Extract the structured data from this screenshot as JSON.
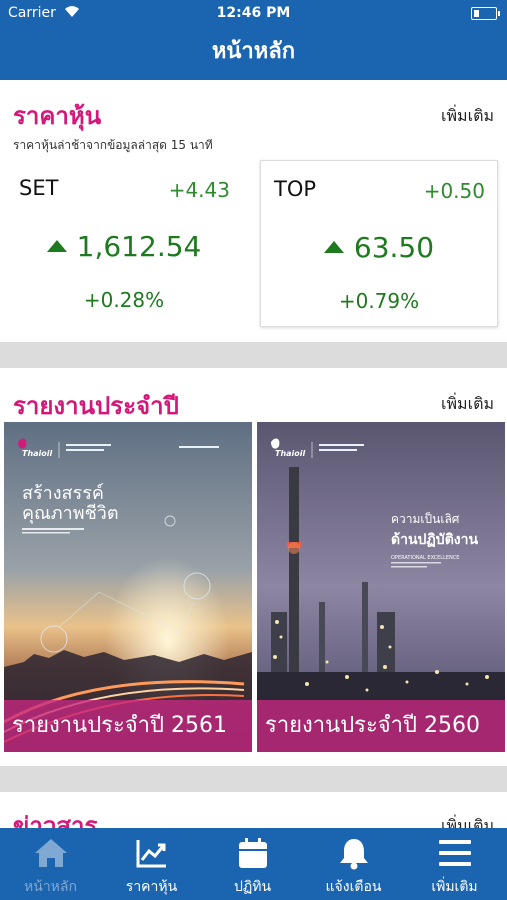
{
  "status": {
    "carrier": "Carrier",
    "time": "12:46 PM"
  },
  "nav": {
    "title": "หน้าหลัก"
  },
  "stock": {
    "title": "ราคาหุ้น",
    "more": "เพิ่มเติม",
    "subtitle": "ราคาหุ้นล่าช้าจากข้อมูลล่าสุด 15 นาที",
    "cards": [
      {
        "name": "SET",
        "change": "+4.43",
        "price": "1,612.54",
        "percent": "+0.28%"
      },
      {
        "name": "TOP",
        "change": "+0.50",
        "price": "63.50",
        "percent": "+0.79%"
      }
    ]
  },
  "reports": {
    "title": "รายงานประจำปี",
    "more": "เพิ่มเติม",
    "items": [
      {
        "label": "รายงานประจำปี 2561",
        "cover_title_1": "สร้างสรรค์",
        "cover_title_2": "คุณภาพชีวิต",
        "brand": "Thaioil"
      },
      {
        "label": "รายงานประจำปี 2560",
        "cover_title_1": "ความเป็นเลิศ",
        "cover_title_2": "ด้านปฏิบัติงาน",
        "cover_sub": "OPERATIONAL EXCELLENCE",
        "brand": "Thaioil"
      }
    ]
  },
  "news": {
    "title": "ข่าวสาร",
    "more": "เพิ่มเติม"
  },
  "tabs": [
    {
      "label": "หน้าหลัก",
      "icon": "home-icon"
    },
    {
      "label": "ราคาหุ้น",
      "icon": "chart-icon"
    },
    {
      "label": "ปฏิทิน",
      "icon": "calendar-icon"
    },
    {
      "label": "แจ้งเตือน",
      "icon": "bell-icon"
    },
    {
      "label": "เพิ่มเติม",
      "icon": "menu-icon"
    }
  ],
  "colors": {
    "primary": "#1a64b0",
    "accent": "#d4187a",
    "up": "#1e7a1e"
  }
}
